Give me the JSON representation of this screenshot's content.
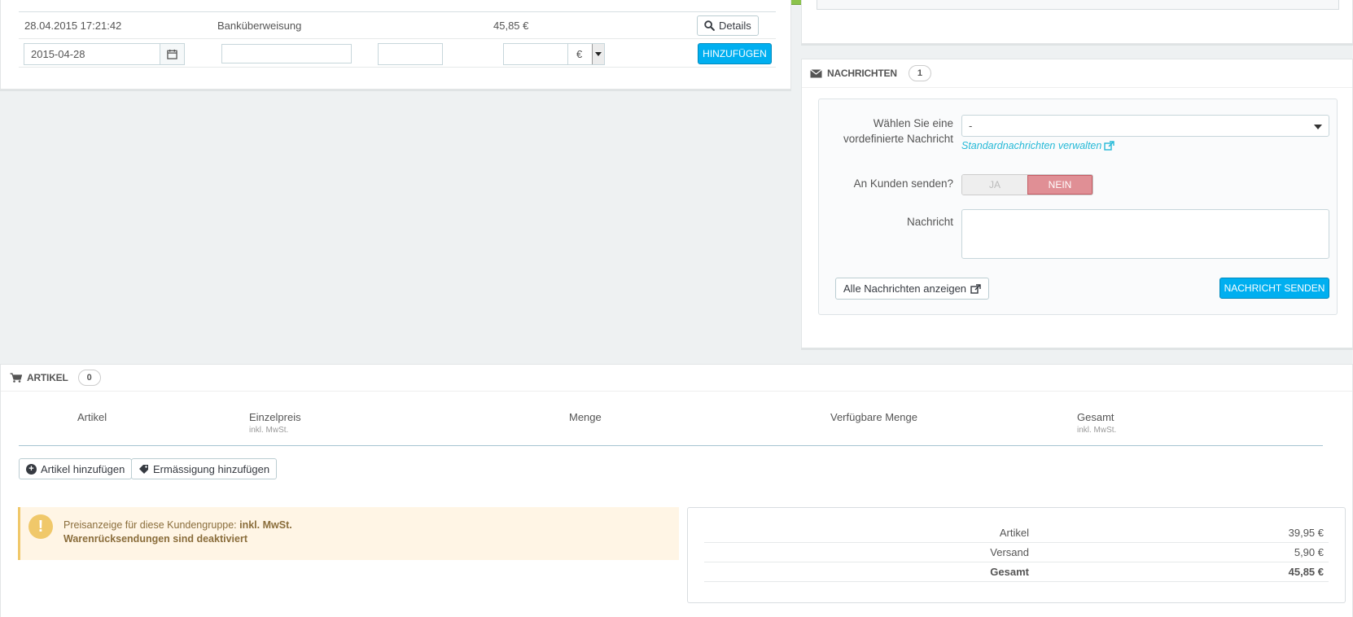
{
  "payments": {
    "row": {
      "date": "28.04.2015 17:21:42",
      "method": "Banküberweisung",
      "amount": "45,85 €",
      "details_label": "Details"
    },
    "form": {
      "date_value": "2015-04-28",
      "currency": "€",
      "add_label": "HINZUFÜGEN"
    }
  },
  "messages": {
    "title": "NACHRICHTEN",
    "count": "1",
    "predefined_label_1": "Wählen Sie eine",
    "predefined_label_2": "vordefinierte Nachricht",
    "predefined_value": "-",
    "manage_link": "Standardnachrichten verwalten",
    "send_to_customer_label": "An Kunden senden?",
    "toggle_yes": "JA",
    "toggle_no": "NEIN",
    "message_label": "Nachricht",
    "show_all_label": "Alle Nachrichten anzeigen",
    "send_label": "NACHRICHT SENDEN"
  },
  "articles": {
    "title": "ARTIKEL",
    "count": "0",
    "columns": [
      {
        "label": "Artikel",
        "sub": ""
      },
      {
        "label": "Einzelpreis",
        "sub": "inkl. MwSt."
      },
      {
        "label": "Menge",
        "sub": ""
      },
      {
        "label": "Verfügbare Menge",
        "sub": ""
      },
      {
        "label": "Gesamt",
        "sub": "inkl. MwSt."
      }
    ],
    "add_article_label": "Artikel hinzufügen",
    "add_discount_label": "Ermässigung hinzufügen",
    "alert_line1_prefix": "Preisanzeige für diese Kundengruppe: ",
    "alert_line1_bold": "inkl. MwSt.",
    "alert_line2": "Warenrücksendungen sind deaktiviert",
    "totals": [
      {
        "label": "Artikel",
        "value": "39,95 €"
      },
      {
        "label": "Versand",
        "value": "5,90 €"
      },
      {
        "label": "Gesamt",
        "value": "45,85 €"
      }
    ]
  },
  "colors": {
    "accent_blue": "#00aff0",
    "danger_soft": "#e08f95",
    "warning_bg": "#fff5e5",
    "topbar_green": "#8bc34a"
  },
  "icons": [
    "search-icon",
    "calendar-icon",
    "envelope-icon",
    "external-link-icon",
    "cart-icon",
    "plus-circle-icon",
    "tag-icon",
    "exclamation-icon",
    "caret-down-icon"
  ]
}
